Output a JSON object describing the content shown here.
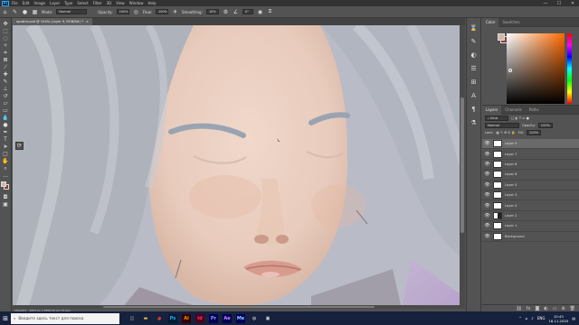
{
  "app": {
    "logo": "Ps"
  },
  "menu": [
    "File",
    "Edit",
    "Image",
    "Layer",
    "Type",
    "Select",
    "Filter",
    "3D",
    "View",
    "Window",
    "Help"
  ],
  "window_controls": [
    "—",
    "☐",
    "✕"
  ],
  "options": {
    "mode_label": "Mode:",
    "mode_value": "Normal",
    "opacity_label": "Opacity:",
    "opacity_value": "100%",
    "flow_label": "Flow:",
    "flow_value": "100%",
    "smoothing_label": "Smoothing:",
    "smoothing_value": "10%",
    "angle_value": "0°"
  },
  "tools": [
    "move-icon",
    "marquee-icon",
    "lasso-icon",
    "quick-select-icon",
    "crop-icon",
    "frame-icon",
    "eyedropper-icon",
    "healing-icon",
    "brush-icon",
    "stamp-icon",
    "history-brush-icon",
    "eraser-icon",
    "gradient-icon",
    "blur-icon",
    "dodge-icon",
    "pen-icon",
    "type-icon",
    "path-select-icon",
    "shape-icon",
    "hand-icon",
    "zoom-icon"
  ],
  "document": {
    "tab_title": "ярайти.psd @ 154% (Layer 9, RGB/8#) *"
  },
  "status": {
    "zoom": "154,44%",
    "info": "3955 px x 3958,35 px (72 ppi)"
  },
  "color_panel": {
    "tabs": [
      "Color",
      "Swatches"
    ]
  },
  "layers_panel": {
    "tabs": [
      "Layers",
      "Channels",
      "Paths"
    ],
    "kind_label": "Kind",
    "blend_mode": "Normal",
    "opacity_label": "Opacity:",
    "opacity_value": "100%",
    "lock_label": "Lock:",
    "fill_label": "Fill:",
    "fill_value": "100%",
    "layers": [
      {
        "name": "Layer 9",
        "selected": true,
        "dark": false,
        "italic": false
      },
      {
        "name": "Layer 7",
        "selected": false,
        "dark": false,
        "italic": false
      },
      {
        "name": "Layer 8",
        "selected": false,
        "dark": false,
        "italic": false
      },
      {
        "name": "Layer 6",
        "selected": false,
        "dark": false,
        "italic": false
      },
      {
        "name": "Layer 5",
        "selected": false,
        "dark": false,
        "italic": false
      },
      {
        "name": "Layer 3",
        "selected": false,
        "dark": false,
        "italic": false
      },
      {
        "name": "Layer 4",
        "selected": false,
        "dark": false,
        "italic": false
      },
      {
        "name": "Layer 2",
        "selected": false,
        "dark": true,
        "italic": false
      },
      {
        "name": "Layer 1",
        "selected": false,
        "dark": false,
        "italic": false
      },
      {
        "name": "Background",
        "selected": false,
        "dark": false,
        "italic": true
      }
    ],
    "footer_icons": [
      "link-icon",
      "fx-icon",
      "mask-icon",
      "adjustment-icon",
      "group-icon",
      "new-layer-icon",
      "trash-icon"
    ]
  },
  "taskbar": {
    "search_placeholder": "Введите здесь текст для поиска",
    "apps": [
      "task-view-icon",
      "explorer-icon",
      "chrome-icon",
      "photoshop-icon",
      "illustrator-icon",
      "indesign-icon",
      "premiere-icon",
      "after-effects-icon",
      "media-encoder-icon",
      "obs-icon",
      "app-icon"
    ],
    "lang": "ENG",
    "time": "10:43",
    "date": "18.11.2020"
  },
  "colors": {
    "fg": "#d0b7a6",
    "bg": "#8b3a3a",
    "accent": "#31a8ff"
  }
}
